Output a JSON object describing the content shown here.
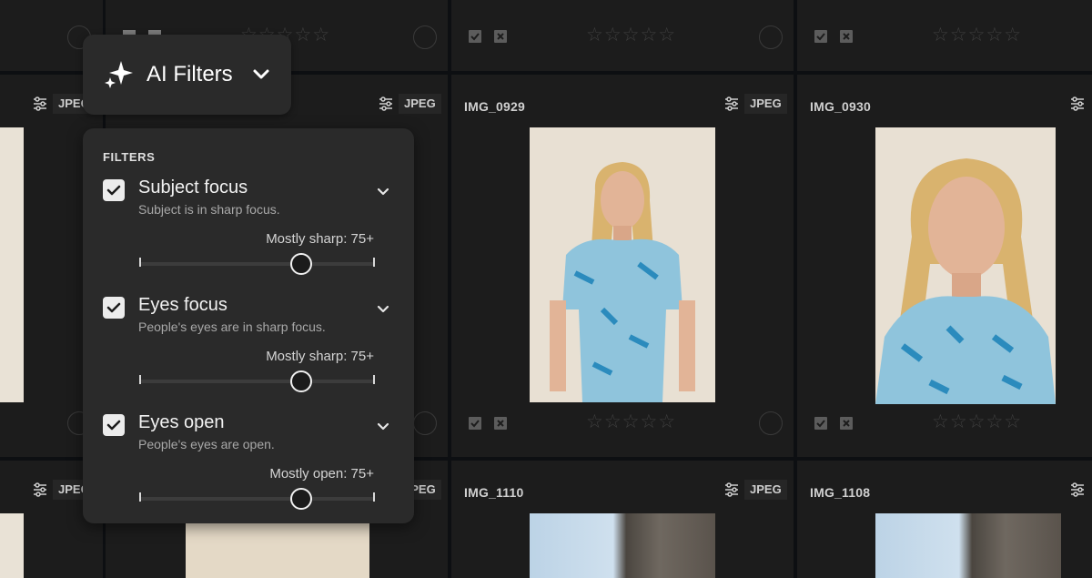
{
  "ai_button": {
    "label": "AI Filters",
    "icon": "sparkle-icon"
  },
  "panel": {
    "heading": "FILTERS",
    "filters": [
      {
        "title": "Subject focus",
        "description": "Subject is in sharp focus.",
        "value_label": "Mostly sharp: 75+",
        "checked": true,
        "level": 0.69
      },
      {
        "title": "Eyes focus",
        "description": "People's eyes are in sharp focus.",
        "value_label": "Mostly sharp: 75+",
        "checked": true,
        "level": 0.69
      },
      {
        "title": "Eyes open",
        "description": "People's eyes are open.",
        "value_label": "Mostly open: 75+",
        "checked": true,
        "level": 0.69
      }
    ]
  },
  "grid": {
    "badge": "JPEG",
    "rating_stars": "☆☆☆☆☆",
    "cells": [
      {
        "name": ""
      },
      {
        "name": ""
      },
      {
        "name": ""
      },
      {
        "name": ""
      },
      {
        "name": ""
      },
      {
        "name": ""
      },
      {
        "name": "IMG_0929"
      },
      {
        "name": "IMG_0930"
      },
      {
        "name": ""
      },
      {
        "name": ""
      },
      {
        "name": "IMG_1110"
      },
      {
        "name": "IMG_1108"
      }
    ]
  },
  "colors": {
    "background": "#0d0f12",
    "cell": "#1c1c1c",
    "panel": "#2a2a2a",
    "accent_text": "#ffffff"
  }
}
